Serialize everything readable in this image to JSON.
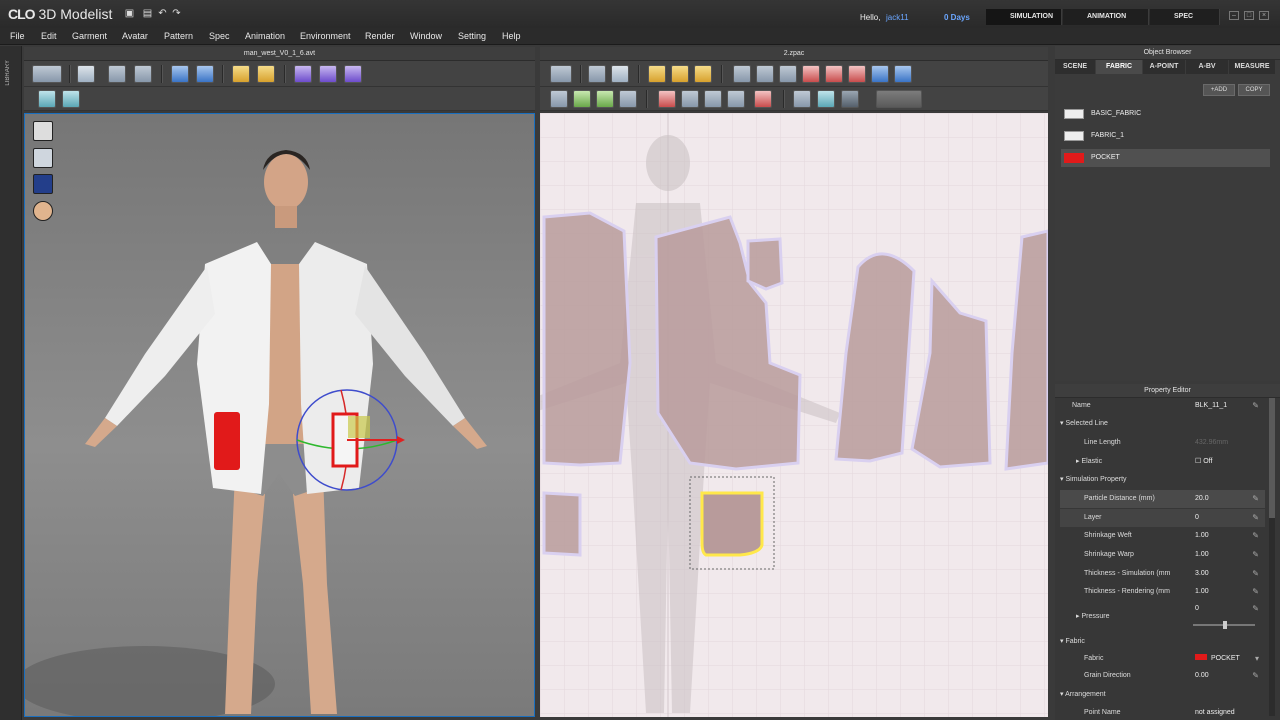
{
  "app": {
    "logo_prefix": "CLO",
    "logo_name": "3D Modelist",
    "hello": "Hello,",
    "user": "jack11",
    "days": "0 Days"
  },
  "mode_tabs": [
    {
      "label": "SIMULATION"
    },
    {
      "label": "ANIMATION"
    },
    {
      "label": "SPEC"
    }
  ],
  "menu": [
    "File",
    "Edit",
    "Garment",
    "Avatar",
    "Pattern",
    "Spec",
    "Animation",
    "Environment",
    "Render",
    "Window",
    "Setting",
    "Help"
  ],
  "library_label": "LIBRARY",
  "view3d": {
    "title": "man_west_V0_1_6.avt"
  },
  "view2d": {
    "title": "2.zpac"
  },
  "object_browser": {
    "title": "Object Browser",
    "tabs": [
      "SCENE",
      "FABRIC",
      "A-POINT",
      "A-BV",
      "MEASURE"
    ],
    "active_tab": "FABRIC",
    "add_label": "ADD",
    "copy_label": "COPY",
    "fabrics": [
      {
        "name": "BASIC_FABRIC",
        "color": "#eeeeee"
      },
      {
        "name": "FABRIC_1",
        "color": "#eeeeee"
      },
      {
        "name": "POCKET",
        "color": "#e11a1a"
      }
    ]
  },
  "property_editor": {
    "title": "Property Editor",
    "rows": [
      {
        "label": "Name",
        "value": "BLK_11_1"
      },
      {
        "label": "Selected Line",
        "value": ""
      },
      {
        "label": "Line Length",
        "value": "432.96mm"
      },
      {
        "label": "Elastic",
        "value": "Off"
      },
      {
        "label": "Simulation Property",
        "value": ""
      },
      {
        "label": "Particle Distance (mm)",
        "value": "20.0"
      },
      {
        "label": "Layer",
        "value": "0"
      },
      {
        "label": "Shrinkage Weft",
        "value": "1.00"
      },
      {
        "label": "Shrinkage Warp",
        "value": "1.00"
      },
      {
        "label": "Thickness - Simulation (mm",
        "value": "3.00"
      },
      {
        "label": "Thickness - Rendering (mm",
        "value": "1.00"
      },
      {
        "label": "Pressure",
        "value": "0"
      },
      {
        "label": "Fabric",
        "value": ""
      },
      {
        "label": "Fabric",
        "value": "POCKET"
      },
      {
        "label": "Grain Direction",
        "value": "0.00"
      },
      {
        "label": "Arrangement",
        "value": ""
      },
      {
        "label": "Point Name",
        "value": "not assigned"
      }
    ]
  },
  "colors": {
    "accent": "#1a6fbf",
    "pocket": "#e11a1a",
    "pattern_fill": "#b89b9b",
    "selected_outline": "#ffe84a"
  }
}
